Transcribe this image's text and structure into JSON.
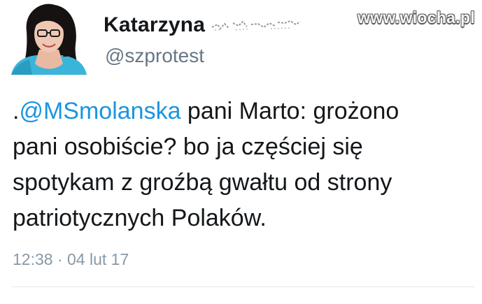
{
  "watermark": "www.wiocha.pl",
  "author": {
    "display_name": "Katarzyna",
    "handle": "@szprotest"
  },
  "tweet": {
    "prefix": ".",
    "mention": "@MSmolanska",
    "line1_rest": " pani Marto: grożono",
    "line2": "pani osobiście? bo ja częściej się",
    "line3": "spotykam z groźbą gwałtu od strony",
    "line4": "patriotycznych Polaków.",
    "time": "12:38",
    "separator": " · ",
    "date": "04 lut 17"
  },
  "colors": {
    "mention": "#1b95e0",
    "meta": "#8899a6",
    "handle": "#657786",
    "text": "#14171a"
  }
}
